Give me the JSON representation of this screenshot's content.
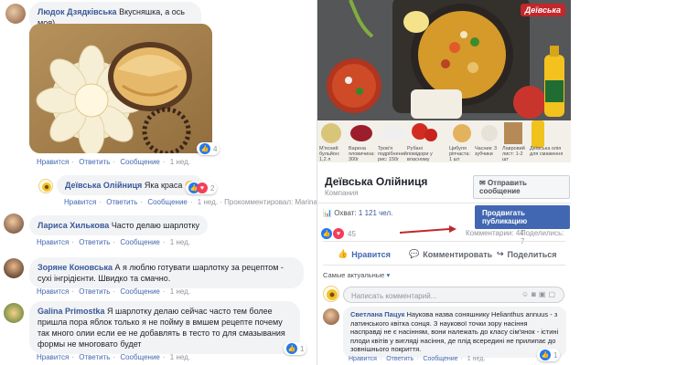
{
  "left_comments": {
    "c1": {
      "author": "Людок Дзядківська",
      "text": "Вкусняшка, а ось моя)",
      "actions": [
        "Нравится",
        "Ответить",
        "Сообщение",
        "1 нед."
      ],
      "reaction_count": "4"
    },
    "reply": {
      "author": "Деївська Олійниця",
      "text": "Яка краса",
      "emoji": "😊",
      "actions": [
        "Нравится",
        "Ответить",
        "Сообщение",
        "1 нед."
      ],
      "prokomment": "· Прокомментировал: Marina Bekovan [?]",
      "reaction_count": "2"
    },
    "c2": {
      "author": "Лариса Хилькова",
      "text": "Часто делаю шарлотку",
      "actions": [
        "Нравится",
        "Ответить",
        "Сообщение",
        "1 нед."
      ]
    },
    "c3": {
      "author": "Зоряне Коновська",
      "text": "А я люблю готувати шарлотку за рецептом - сухі інгрідієнти. Швидко та смачно.",
      "actions": [
        "Нравится",
        "Ответить",
        "Сообщение",
        "1 нед."
      ]
    },
    "c4": {
      "author": "Galina Primostka",
      "text": "Я шарлотку делаю сейчас часто тем более пришла пора яблок только я не пойму в вмшем рецепте почему так много олии если ее не добавлять в тесто то для смазывания формы не многовато будет",
      "actions": [
        "Нравится",
        "Ответить",
        "Сообщение",
        "1 нед."
      ],
      "reaction_count": "1"
    }
  },
  "post": {
    "brand_logo": "Деївська",
    "captions": [
      "М'ясний бульйон: 1,2 л",
      "Варена яловичина: 300г",
      "Бурякова паста: 1 шт",
      "Тров'я подрібнений рис: 150г",
      "Рубані помідори у власному соку: 250г",
      "Цибуля ріпчаста: 1 шт",
      "Часник: 3 зубчики",
      "Лавровий лист: 1-2 шт",
      "Деївська олія для смаження"
    ],
    "page_name": "Деївська Олійниця",
    "page_type": "Компания",
    "send_message": "Отправить сообщение",
    "reach": "Охват:",
    "reach_value": "1 121 чел.",
    "promote": "Продвигать публикацию",
    "reactions_count": "45",
    "comments_count": "Комментарии: 44",
    "shares_count": "Поделились: 7",
    "like_btn": "Нравится",
    "comment_btn": "Комментировать",
    "share_btn": "Поделиться",
    "sort_label": "Самые актуальные",
    "comment_placeholder": "Написать комментарий...",
    "reply": {
      "author": "Светлана Пацук",
      "text": "Наукова назва соняшнику Helianthus annuus - з латинського квітка сонця. З наукової точки зору насіння насправді не є насінням, вони належать до класу сім'янок - істині плоди квітів у вигляді насіння, де плід всередині не прилипає до зовнішнього покриття.",
      "actions": [
        "Нравится",
        "Ответить",
        "Сообщение",
        "1 нед."
      ],
      "reaction_count": "1"
    }
  },
  "colors": {
    "link": "#385898",
    "action": "#4267b2",
    "arrow": "#c0282d"
  }
}
